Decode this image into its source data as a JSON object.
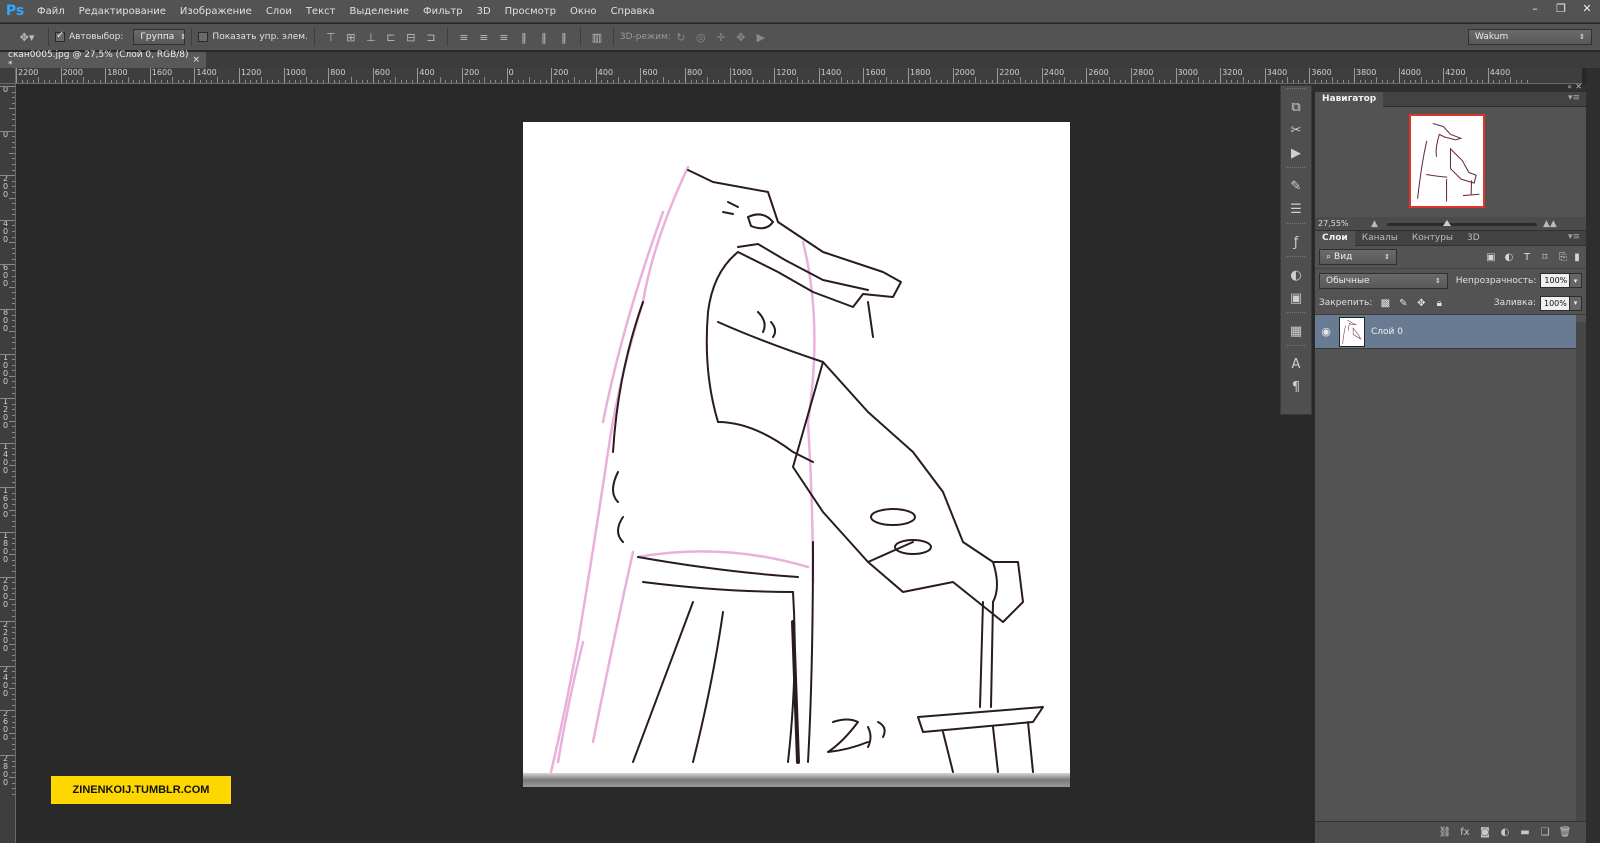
{
  "app": {
    "logo": "Ps"
  },
  "menu": [
    "Файл",
    "Редактирование",
    "Изображение",
    "Слои",
    "Текст",
    "Выделение",
    "Фильтр",
    "3D",
    "Просмотр",
    "Окно",
    "Справка"
  ],
  "window_controls": {
    "minimize": "–",
    "restore": "❐",
    "close": "✕"
  },
  "options": {
    "auto_select_label": "Автовыбор:",
    "auto_select_value": "Группа",
    "show_transform_label": "Показать упр. элем.",
    "mode_3d_label": "3D-режим:",
    "workspace": "Wakum"
  },
  "document": {
    "tab_title": "скан0005.jpg @ 27,5% (Слой 0, RGB/8) *",
    "tab_close": "×"
  },
  "ruler": {
    "top": [
      "2200",
      "2000",
      "1800",
      "1600",
      "1400",
      "1200",
      "1000",
      "800",
      "600",
      "400",
      "200",
      "0",
      "200",
      "400",
      "600",
      "800",
      "1000",
      "1200",
      "1400",
      "1600",
      "1800",
      "2000",
      "2200",
      "2400",
      "2600",
      "2800",
      "3000",
      "3200",
      "3400",
      "3600",
      "3800",
      "4000",
      "4200",
      "4400"
    ],
    "left": [
      "0",
      "0",
      "200",
      "400",
      "600",
      "800",
      "1000",
      "1200",
      "1400",
      "1600",
      "1800",
      "2000",
      "2200",
      "2400",
      "2600",
      "2800"
    ]
  },
  "watermark": "ZINENKOIJ.TUMBLR.COM",
  "navigator": {
    "tab": "Навигатор",
    "zoom": "27,55%",
    "zoom_level": 0.4
  },
  "layers": {
    "tabs": [
      "Слои",
      "Каналы",
      "Контуры",
      "3D"
    ],
    "filter": "Вид",
    "blend_mode": "Обычные",
    "opacity_label": "Непрозрачность:",
    "opacity": "100%",
    "lock_label": "Закрепить:",
    "fill_label": "Заливка:",
    "fill": "100%",
    "items": [
      {
        "name": "Слой 0",
        "visible_icon": "eye-icon"
      }
    ]
  },
  "colors": {
    "accent_selection": "#687b93",
    "ps_blue": "#31a8ff",
    "watermark_bg": "#ffd700"
  }
}
